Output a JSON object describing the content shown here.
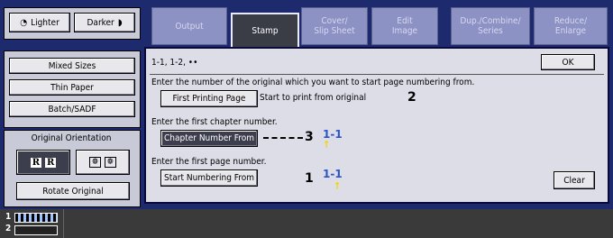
{
  "left": {
    "lighter_label": "Lighter",
    "darker_label": "Darker",
    "mixed_sizes": "Mixed Sizes",
    "thin_paper": "Thin Paper",
    "batch_sadf": "Batch/SADF",
    "orientation_title": "Original Orientation",
    "rotate_original": "Rotate Original"
  },
  "tabs": [
    {
      "line1": "Output",
      "line2": ""
    },
    {
      "line1": "Stamp",
      "line2": ""
    },
    {
      "line1": "Cover/",
      "line2": "Slip Sheet"
    },
    {
      "line1": "Edit",
      "line2": "Image"
    },
    {
      "line1": "Dup./Combine/",
      "line2": "Series"
    },
    {
      "line1": "Reduce/",
      "line2": "Enlarge"
    }
  ],
  "main": {
    "title": "1-1, 1-2, ••",
    "ok": "OK",
    "instr1": "Enter the number of the original which you want to start page numbering from.",
    "first_printing_page": "First Printing Page",
    "start_print_text": "Start to print from original",
    "callout2": "2",
    "instr2": "Enter the first chapter number.",
    "chapter_number_from": "Chapter Number From",
    "callout3": "3",
    "sample1": "1-1",
    "instr3": "Enter the first page number.",
    "start_numbering_from": "Start Numbering From",
    "callout1": "1",
    "sample2": "1-1",
    "clear": "Clear"
  },
  "bottom": {
    "tray1": "1",
    "tray2": "2"
  }
}
